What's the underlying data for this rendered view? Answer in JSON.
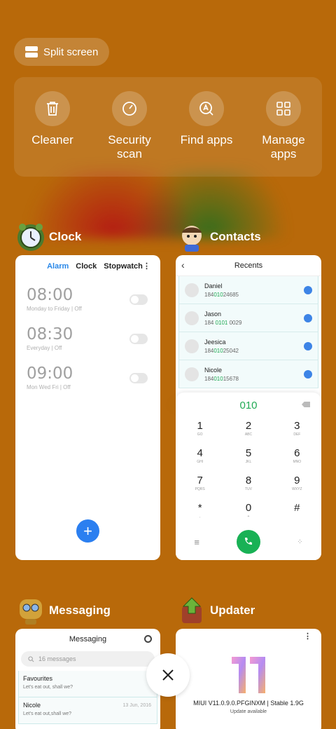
{
  "split_screen": {
    "label": "Split screen"
  },
  "quick_actions": [
    {
      "label": "Cleaner",
      "icon": "trash-icon"
    },
    {
      "label": "Security\nscan",
      "icon": "security-gauge-icon"
    },
    {
      "label": "Find apps",
      "icon": "find-apps-icon"
    },
    {
      "label": "Manage\napps",
      "icon": "grid-icon"
    }
  ],
  "apps": {
    "clock": {
      "title": "Clock",
      "tabs": [
        "Alarm",
        "Clock",
        "Stopwatch"
      ],
      "alarms": [
        {
          "time": "08:00",
          "repeat": "Monday to Friday | Off"
        },
        {
          "time": "08:30",
          "repeat": "Everyday | Off"
        },
        {
          "time": "09:00",
          "repeat": "Mon Wed Fri | Off"
        }
      ],
      "add_label": "+"
    },
    "contacts": {
      "title": "Contacts",
      "header": "Recents",
      "recents": [
        {
          "name": "Daniel",
          "pre": "184",
          "hl": "010",
          "post": "24685"
        },
        {
          "name": "Jason",
          "pre": "184 ",
          "hl": "0101",
          "post": " 0029"
        },
        {
          "name": "Jeesica",
          "pre": "184",
          "hl": "010",
          "post": "25042"
        },
        {
          "name": "Nicole",
          "pre": "184",
          "hl": "010",
          "post": "15678"
        }
      ],
      "dial_input": "010",
      "keys": [
        {
          "n": "1",
          "l": "GO"
        },
        {
          "n": "2",
          "l": "ABC"
        },
        {
          "n": "3",
          "l": "DEF"
        },
        {
          "n": "4",
          "l": "GHI"
        },
        {
          "n": "5",
          "l": "JKL"
        },
        {
          "n": "6",
          "l": "MNO"
        },
        {
          "n": "7",
          "l": "PQRS"
        },
        {
          "n": "8",
          "l": "TUV"
        },
        {
          "n": "9",
          "l": "WXYZ"
        },
        {
          "n": "*",
          "l": ","
        },
        {
          "n": "0",
          "l": "+"
        },
        {
          "n": "#",
          "l": ""
        }
      ]
    },
    "messaging": {
      "title": "Messaging",
      "header": "Messaging",
      "search_placeholder": "16 messages",
      "threads": [
        {
          "name": "Favourites",
          "preview": "Let's eat out, shall we?",
          "date": ""
        },
        {
          "name": "Nicole",
          "preview": "Let's eat out,shall we?",
          "date": "13 Jun, 2016"
        }
      ]
    },
    "updater": {
      "title": "Updater",
      "version": "MIUI V11.0.9.0.PFGINXM | Stable 1.9G",
      "status": "Update available"
    }
  },
  "colors": {
    "background": "#b8690a",
    "accent": "#2b7ff0",
    "call_green": "#19b155"
  }
}
